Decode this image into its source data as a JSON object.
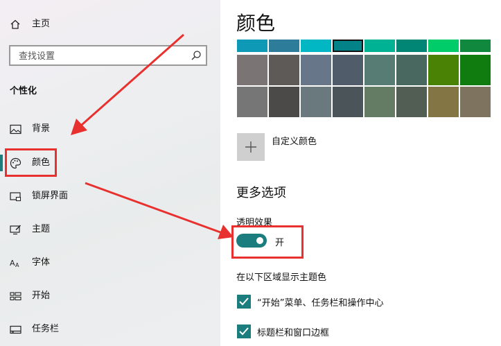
{
  "sidebar": {
    "home_label": "主页",
    "search": {
      "placeholder": "查找设置",
      "value": ""
    },
    "section_title": "个性化",
    "items": [
      {
        "label": "背景",
        "icon": "picture-icon"
      },
      {
        "label": "颜色",
        "icon": "palette-icon",
        "selected": true
      },
      {
        "label": "锁屏界面",
        "icon": "lock-screen-icon"
      },
      {
        "label": "主题",
        "icon": "theme-icon"
      },
      {
        "label": "字体",
        "icon": "font-icon"
      },
      {
        "label": "开始",
        "icon": "start-icon"
      },
      {
        "label": "任务栏",
        "icon": "taskbar-icon"
      }
    ]
  },
  "main": {
    "title": "颜色",
    "palette": {
      "rows": [
        [
          "#0e99b7",
          "#2d7d9a",
          "#00b7c3",
          "#038387",
          "#00b294",
          "#018574",
          "#00cc6a",
          "#10893e"
        ],
        [
          "#7a7574",
          "#5d5a58",
          "#68768a",
          "#515c6b",
          "#567c73",
          "#486860",
          "#498205",
          "#107c10"
        ],
        [
          "#767676",
          "#4c4a48",
          "#69797e",
          "#4a5459",
          "#647c64",
          "#525e54",
          "#847545",
          "#7e735f"
        ]
      ],
      "selected": "#038387"
    },
    "custom_color_label": "自定义颜色",
    "more_options_title": "更多选项",
    "transparency": {
      "label": "透明效果",
      "state_label": "开",
      "on": true
    },
    "accent_surfaces": {
      "label": "在以下区域显示主题色",
      "options": [
        {
          "label": "“开始”菜单、任务栏和操作中心",
          "checked": true
        },
        {
          "label": "标题栏和窗口边框",
          "checked": true
        }
      ]
    }
  },
  "colors": {
    "accent": "#1c7d7e",
    "annotation": "#e8312f"
  }
}
